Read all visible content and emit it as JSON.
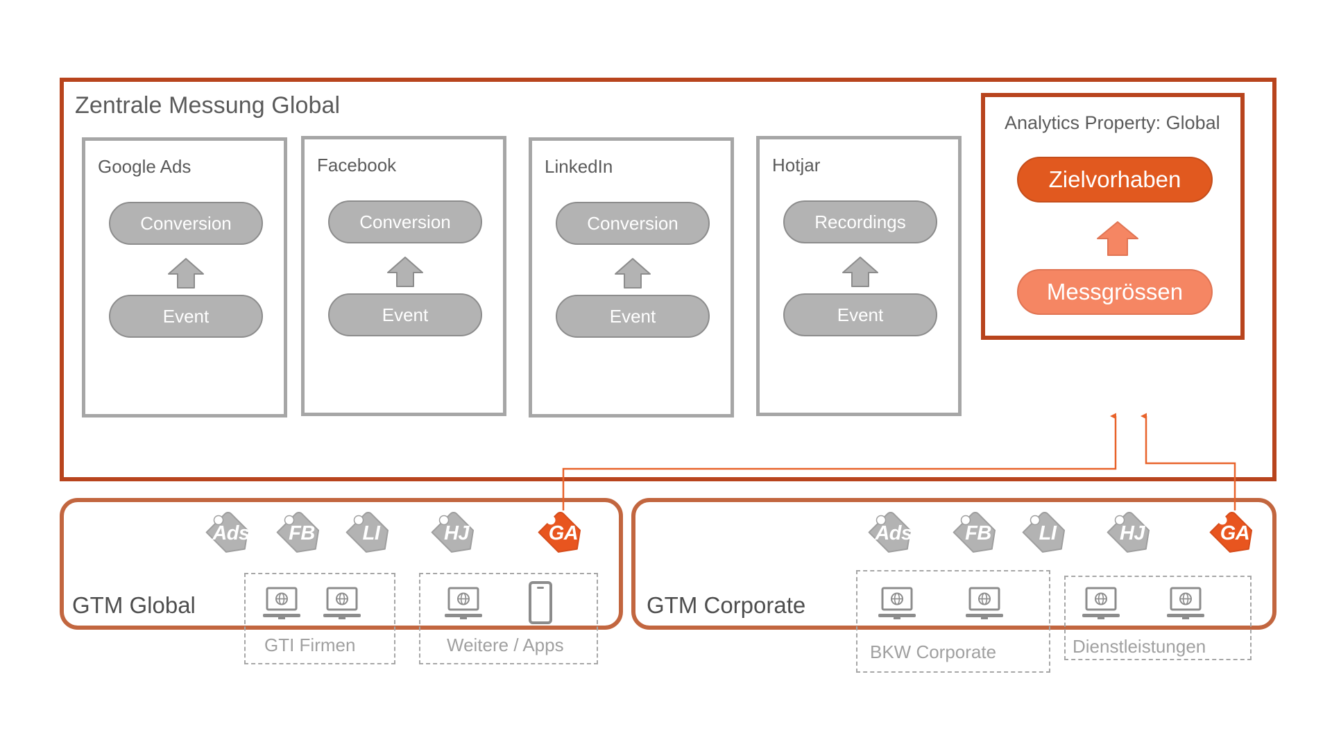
{
  "diagram": {
    "title": "Zentrale Messung Global",
    "accent_dark": "#B8441D",
    "accent_mid": "#C2663F",
    "accent_orange": "#E1591F",
    "accent_light_orange": "#F58663",
    "gray": "#a6a6a6",
    "gray_fill": "#b3b3b3",
    "connector_color": "#E8622A"
  },
  "channels": [
    {
      "name": "Google Ads",
      "top_pill": "Conversion",
      "bottom_pill": "Event",
      "arrow": "up-arrow"
    },
    {
      "name": "Facebook",
      "top_pill": "Conversion",
      "bottom_pill": "Event",
      "arrow": "up-arrow"
    },
    {
      "name": "LinkedIn",
      "top_pill": "Conversion",
      "bottom_pill": "Event",
      "arrow": "up-arrow"
    },
    {
      "name": "Hotjar",
      "top_pill": "Recordings",
      "bottom_pill": "Event",
      "arrow": "up-arrow"
    }
  ],
  "analytics": {
    "title": "Analytics Property: Global",
    "goal_pill": "Zielvorhaben",
    "metric_pill": "Messgrössen",
    "arrow": "up-arrow"
  },
  "gtm_global": {
    "label": "GTM Global",
    "tags": [
      {
        "label": "Ads",
        "highlight": false
      },
      {
        "label": "FB",
        "highlight": false
      },
      {
        "label": "LI",
        "highlight": false
      },
      {
        "label": "HJ",
        "highlight": false
      },
      {
        "label": "GA",
        "highlight": true
      }
    ],
    "groups": [
      {
        "label": "GTI Firmen",
        "devices": [
          "laptop-globe-icon",
          "laptop-globe-icon"
        ]
      },
      {
        "label": "Weitere / Apps",
        "devices": [
          "laptop-globe-icon",
          "smartphone-icon"
        ]
      }
    ]
  },
  "gtm_corporate": {
    "label": "GTM Corporate",
    "tags": [
      {
        "label": "Ads",
        "highlight": false
      },
      {
        "label": "FB",
        "highlight": false
      },
      {
        "label": "LI",
        "highlight": false
      },
      {
        "label": "HJ",
        "highlight": false
      },
      {
        "label": "GA",
        "highlight": true
      }
    ],
    "groups": [
      {
        "label": "BKW Corporate",
        "devices": [
          "laptop-globe-icon",
          "laptop-globe-icon"
        ]
      },
      {
        "label": "Dienstleistungen",
        "devices": [
          "laptop-globe-icon",
          "laptop-globe-icon"
        ]
      }
    ]
  }
}
